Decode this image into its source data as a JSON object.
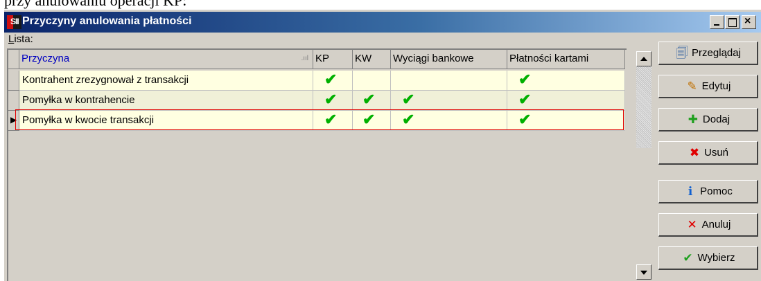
{
  "document_fragment": "przy anulowaniu operacji KP:",
  "window": {
    "title": "Przyczyny anulowania płatności",
    "icon_text": "SII",
    "controls": {
      "minimize": "minimize",
      "maximize": "maximize",
      "close": "×"
    }
  },
  "list_label": "Lista:",
  "table": {
    "columns": [
      "Przyczyna",
      "KP",
      "KW",
      "Wyciągi bankowe",
      "Płatności kartami"
    ],
    "check_glyph": "✔",
    "rows": [
      {
        "label": "Kontrahent zrezygnował z transakcji",
        "kp": true,
        "kw": false,
        "wyciagi": false,
        "karty": true
      },
      {
        "label": "Pomyłka w kontrahencie",
        "kp": true,
        "kw": true,
        "wyciagi": true,
        "karty": true
      },
      {
        "label": "Pomyłka w kwocie transakcji",
        "kp": true,
        "kw": true,
        "wyciagi": true,
        "karty": true
      }
    ],
    "selected_row": 2,
    "header_color": "#0000c0",
    "row_marker": "▶"
  },
  "actions": [
    {
      "label": "Przeglądaj",
      "icon": "browse-icon",
      "glyph": "🗐"
    },
    {
      "label": "Edytuj",
      "icon": "edit-icon",
      "glyph": "✎"
    },
    {
      "label": "Dodaj",
      "icon": "add-icon",
      "glyph": "✚"
    },
    {
      "label": "Usuń",
      "icon": "delete-icon",
      "glyph": "✖"
    },
    {
      "label": "Pomoc",
      "icon": "help-icon",
      "glyph": "ℹ"
    },
    {
      "label": "Anuluj",
      "icon": "cancel-icon",
      "glyph": "✕"
    },
    {
      "label": "Wybierz",
      "icon": "select-icon",
      "glyph": "✔"
    }
  ]
}
